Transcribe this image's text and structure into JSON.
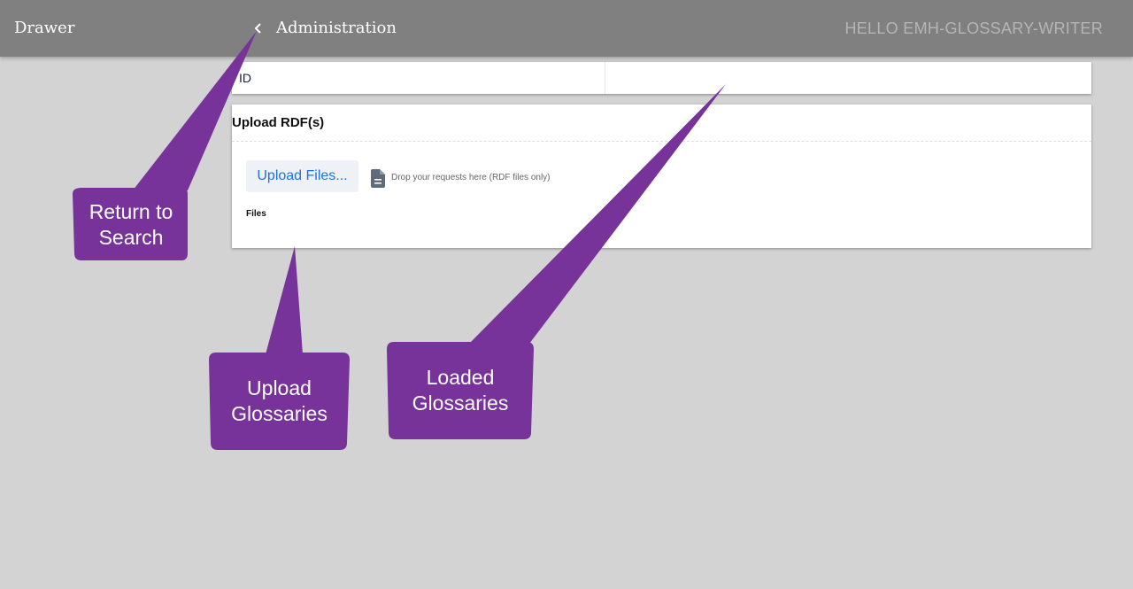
{
  "header": {
    "drawer_label": "Drawer",
    "page_title": "Administration",
    "greeting": "HELLO EMH-GLOSSARY-WRITER",
    "bg_color": "#808080"
  },
  "id_table": {
    "column_header": "ID"
  },
  "upload": {
    "title": "Upload RDF(s)",
    "button_label": "Upload Files...",
    "drop_hint": "Drop your requests here (RDF files only)",
    "files_label": "Files",
    "icon": "document-icon",
    "button_color": "#1a73e8"
  },
  "callouts": {
    "color": "#773399",
    "return_line1": "Return to",
    "return_line2": "Search",
    "upload_line1": "Upload",
    "upload_line2": "Glossaries",
    "loaded_line1": "Loaded",
    "loaded_line2": "Glossaries"
  }
}
